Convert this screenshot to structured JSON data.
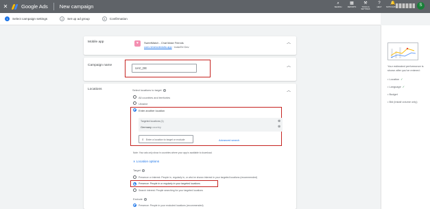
{
  "topbar": {
    "close_glyph": "✕",
    "brand": "Google Ads",
    "page_title": "New campaign",
    "tools": [
      {
        "icon": "search-icon",
        "glyph": "⌕",
        "label": "SEARCH"
      },
      {
        "icon": "reports-icon",
        "glyph": "▦",
        "label": "REPORTS"
      },
      {
        "icon": "tools-icon",
        "glyph": "⚒",
        "label": "TOOLS & SETTINGS"
      },
      {
        "icon": "help-icon",
        "glyph": "?",
        "label": "HELP"
      },
      {
        "icon": "notifications-icon",
        "glyph": "🔔",
        "label": "NOTIFICATIONS"
      }
    ],
    "avatar_letter": "S"
  },
  "stepper": {
    "steps": [
      {
        "num": "1",
        "label": "Select campaign settings"
      },
      {
        "num": "2",
        "label": "Set up ad group"
      },
      {
        "num": "3",
        "label": "Confirmation"
      }
    ]
  },
  "mobile_app": {
    "title": "Mobile app",
    "app_name": "SweetMatch - Chat Make Friends",
    "app_package": "com.nimerodeduitu.app",
    "app_dev": "· IndiaTel Dev"
  },
  "campaign_name": {
    "title": "Campaign name",
    "value": "UAC_DE"
  },
  "locations": {
    "title": "Locations",
    "select_label": "Select locations to target",
    "options": [
      "All countries and territories",
      "Ukraine",
      "Enter another location"
    ],
    "targeted_header": "Targeted locations (1)",
    "targeted_item": "Germany",
    "targeted_item_type": "country",
    "search_placeholder": "Enter a location to target or exclude",
    "advanced_search": "Advanced search",
    "note": "Note: Your ads only show in countries where your app is available to download.",
    "location_options": "Location options",
    "target_label": "Target",
    "target_options": [
      "Presence or interest: People in, regularly in, or who've shown interest in your targeted locations (recommended)",
      "Presence: People in or regularly in your targeted locations",
      "Search interest: People searching for your targeted locations"
    ],
    "exclude_label": "Exclude",
    "exclude_option": "Presence: People in your excluded locations (recommended)"
  },
  "side_panel": {
    "description": "Your estimated performance is shown after you've entered:",
    "criteria": [
      {
        "label": "Location",
        "done": "✓"
      },
      {
        "label": "Language",
        "done": "✓"
      },
      {
        "label": "Budget",
        "done": ""
      },
      {
        "label": "Bid (install volume only)",
        "done": ""
      }
    ]
  },
  "colors": {
    "accent": "#1a73e8",
    "highlight": "#c5221f",
    "topbar": "#5f6368"
  }
}
